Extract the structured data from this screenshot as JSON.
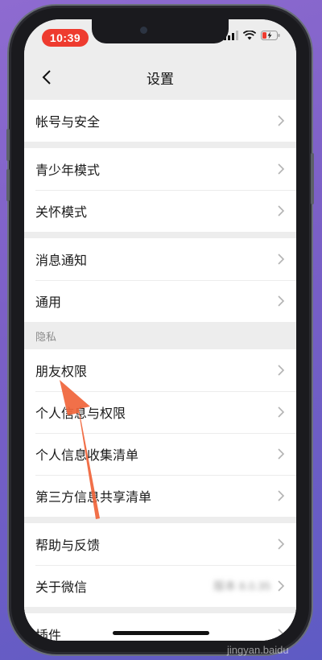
{
  "status": {
    "time": "10:39"
  },
  "nav": {
    "title": "设置"
  },
  "groups": [
    {
      "items": [
        {
          "label": "帐号与安全"
        }
      ]
    },
    {
      "items": [
        {
          "label": "青少年模式"
        },
        {
          "label": "关怀模式"
        }
      ]
    },
    {
      "items": [
        {
          "label": "消息通知"
        },
        {
          "label": "通用"
        }
      ]
    },
    {
      "header": "隐私",
      "items": [
        {
          "label": "朋友权限"
        },
        {
          "label": "个人信息与权限"
        },
        {
          "label": "个人信息收集清单"
        },
        {
          "label": "第三方信息共享清单"
        }
      ]
    },
    {
      "items": [
        {
          "label": "帮助与反馈"
        },
        {
          "label": "关于微信",
          "value": "版本 8.0.35"
        }
      ]
    },
    {
      "items": [
        {
          "label": "插件"
        }
      ]
    }
  ],
  "overlay": {
    "arrow_color": "#f0643a",
    "watermark": "jingyan.baidu"
  },
  "colors": {
    "time_pill": "#ee3b2f",
    "page_bg": "#ededed"
  }
}
